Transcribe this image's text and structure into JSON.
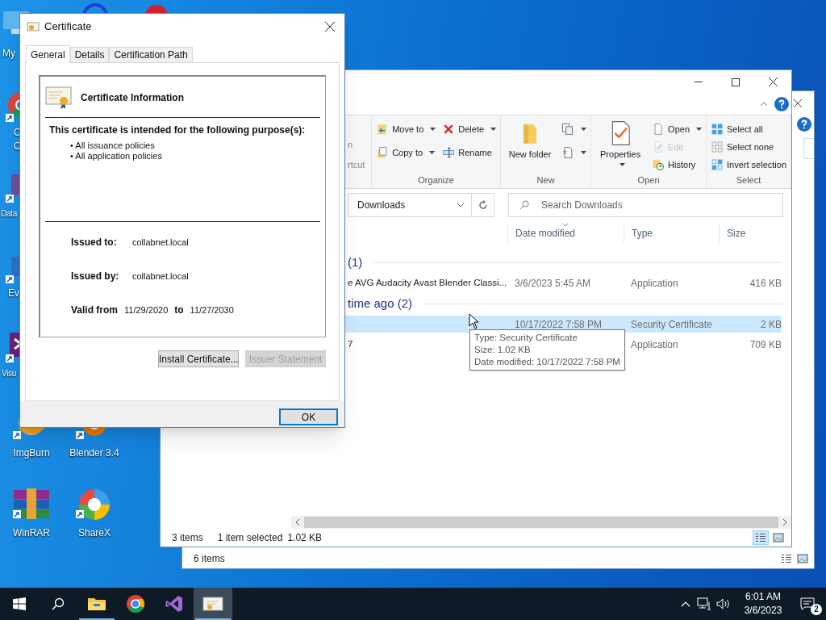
{
  "desktop_icons": [
    {
      "kind": "pc",
      "lines": [
        "My"
      ]
    },
    {
      "kind": "chrome",
      "lines": [
        "C",
        "C"
      ]
    },
    {
      "kind": "data",
      "lines": [
        "Data"
      ]
    },
    {
      "kind": "app",
      "lines": [
        "Ev"
      ]
    },
    {
      "kind": "vs",
      "lines": [
        "Visu"
      ]
    },
    {
      "kind": "imgburn",
      "lines": [
        "ImgBurn"
      ]
    },
    {
      "kind": "blender",
      "lines": [
        "Blender 3.4"
      ]
    },
    {
      "kind": "winrar",
      "lines": [
        "WinRAR"
      ]
    },
    {
      "kind": "sharex",
      "lines": [
        "ShareX"
      ]
    },
    {
      "kind": "edge"
    },
    {
      "kind": "opera"
    }
  ],
  "back_window": {
    "status": "6 items"
  },
  "explorer": {
    "ribbon": {
      "clipped_labels": [
        "n",
        "rtcut"
      ],
      "groups": [
        {
          "name": "Organize",
          "columns": [
            [
              {
                "kind": "move",
                "label": "Move to",
                "large": false,
                "dropdown": true,
                "disabled": false
              },
              {
                "kind": "copy",
                "label": "Copy to",
                "large": false,
                "dropdown": true,
                "disabled": false
              }
            ],
            [
              {
                "kind": "delete",
                "label": "Delete",
                "large": false,
                "dropdown": true,
                "disabled": false
              },
              {
                "kind": "rename",
                "label": "Rename",
                "large": false,
                "dropdown": false,
                "disabled": false
              }
            ]
          ]
        },
        {
          "name": "New",
          "columns": [
            [
              {
                "kind": "newfolder",
                "label": "New folder",
                "large": true,
                "dropdown": false,
                "disabled": false
              }
            ],
            [
              {
                "kind": "newitem",
                "large": false,
                "dropdown": true,
                "disabled": false
              },
              {
                "kind": "easyaccess",
                "large": false,
                "dropdown": true,
                "disabled": false
              }
            ]
          ]
        },
        {
          "name": "Open",
          "columns": [
            [
              {
                "kind": "properties",
                "label": "Properties",
                "large": true,
                "dropdown": true,
                "disabled": false
              }
            ],
            [
              {
                "kind": "open",
                "label": "Open",
                "large": false,
                "dropdown": true,
                "disabled": false
              },
              {
                "kind": "edit",
                "label": "Edit",
                "large": false,
                "dropdown": false,
                "disabled": true
              },
              {
                "kind": "history",
                "label": "History",
                "large": false,
                "dropdown": false,
                "disabled": false
              }
            ]
          ]
        },
        {
          "name": "Select",
          "columns": [
            [
              {
                "kind": "selectall",
                "label": "Select all",
                "large": false,
                "dropdown": false,
                "disabled": false
              },
              {
                "kind": "selectnone",
                "label": "Select none",
                "large": false,
                "dropdown": false,
                "disabled": false
              },
              {
                "kind": "invert",
                "label": "Invert selection",
                "large": false,
                "dropdown": false,
                "disabled": false
              }
            ]
          ]
        }
      ]
    },
    "address": "Downloads",
    "search": {
      "placeholder": "Search Downloads"
    },
    "columns": [
      "Date modified",
      "Type",
      "Size"
    ],
    "groups": [
      {
        "header": "(1)",
        "rows": [
          {
            "name": "e AVG Audacity Avast Blender Classi...",
            "date": "3/6/2023 5:45 AM",
            "type": "Application",
            "size": "416 KB",
            "selected": false
          }
        ]
      },
      {
        "header": "time ago (2)",
        "rows": [
          {
            "date": "10/17/2022 7:58 PM",
            "type": "Security Certificate",
            "size": "2 KB",
            "selected": true
          },
          {
            "name": "7",
            "type": "Application",
            "size": "709 KB",
            "selected": false
          }
        ]
      }
    ],
    "tooltip": [
      "Type: Security Certificate",
      "Size: 1.02 KB",
      "Date modified: 10/17/2022 7:58 PM"
    ],
    "status": {
      "count": "3 items",
      "selected": "1 item selected",
      "size": "1.02 KB"
    },
    "views": [
      {
        "kind": "details",
        "selected": true
      },
      {
        "kind": "large",
        "selected": false
      }
    ]
  },
  "dialog": {
    "title": "Certificate",
    "tabs": [
      {
        "label": "General",
        "selected": true
      },
      {
        "label": "Details",
        "selected": false
      },
      {
        "label": "Certification Path",
        "selected": false
      }
    ],
    "heading": "Certificate Information",
    "purpose_title": "This certificate is intended for the following purpose(s):",
    "purposes": [
      "• All issuance policies",
      "• All application policies"
    ],
    "fields": [
      {
        "label": "Issued to:",
        "value": "collabnet.local"
      },
      {
        "label": "Issued by:",
        "value": "collabnet.local"
      }
    ],
    "valid": {
      "label": "Valid from",
      "from": "11/29/2020",
      "to_label": "to",
      "to": "11/27/2030"
    },
    "buttons": [
      {
        "label": "Install Certificate...",
        "disabled": false
      },
      {
        "label": "Issuer Statement",
        "disabled": true
      }
    ],
    "ok": "OK"
  },
  "taskbar": {
    "apps": [
      {
        "kind": "explorer",
        "running": true,
        "active": false
      },
      {
        "kind": "chrome",
        "running": false,
        "active": false
      },
      {
        "kind": "vs",
        "running": false,
        "active": false
      },
      {
        "kind": "certificate",
        "running": true,
        "active": true
      }
    ],
    "time": "6:01 AM",
    "date": "3/6/2023",
    "notifications": "2"
  }
}
